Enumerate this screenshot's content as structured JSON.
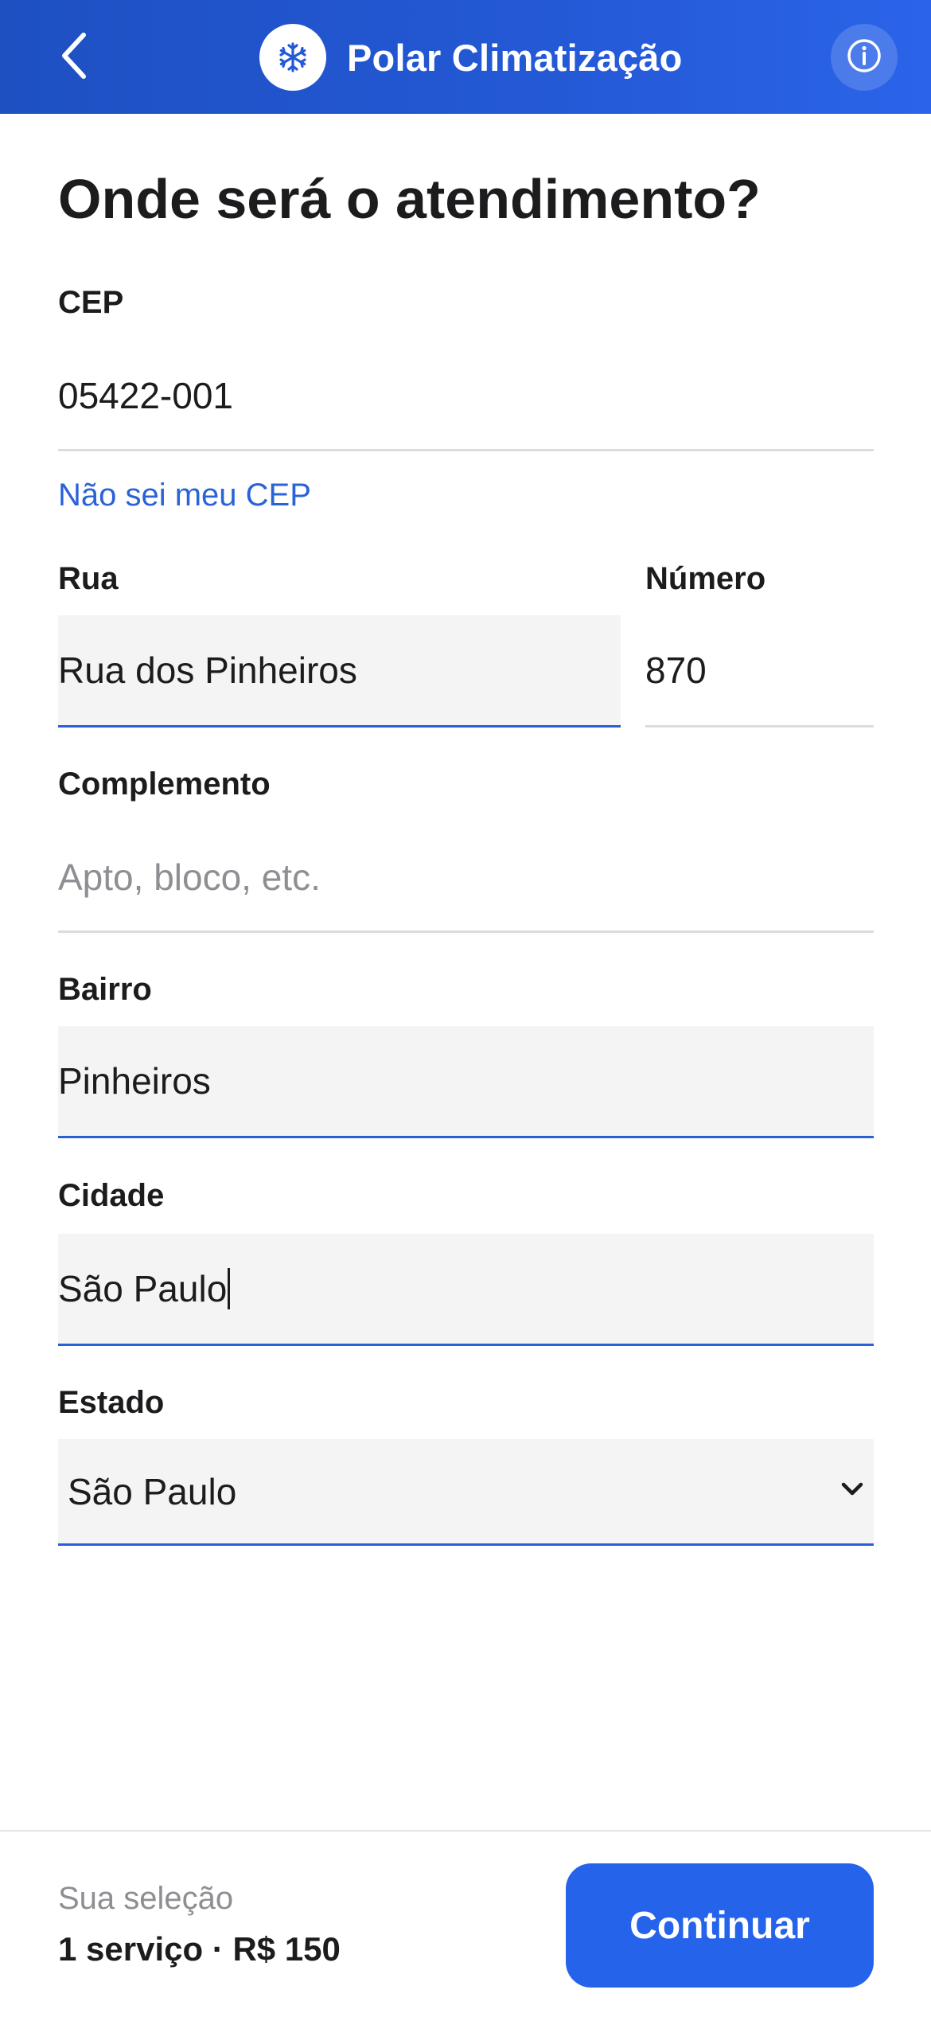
{
  "header": {
    "back_icon": "chevron-left-icon",
    "logo_icon": "snowflake-icon",
    "title": "Polar Climatização",
    "info_icon": "info-icon",
    "colors": {
      "gradient_start": "#1e50c2",
      "gradient_end": "#2b64ea"
    }
  },
  "page": {
    "title": "Onde será o atendimento?"
  },
  "form": {
    "cep": {
      "label": "CEP",
      "value": "05422-001"
    },
    "cep_help_link": "Não sei meu CEP",
    "rua": {
      "label": "Rua",
      "value": "Rua dos Pinheiros"
    },
    "numero": {
      "label": "Número",
      "value": "870"
    },
    "complemento": {
      "label": "Complemento",
      "value": "",
      "placeholder": "Apto, bloco, etc."
    },
    "bairro": {
      "label": "Bairro",
      "value": "Pinheiros"
    },
    "cidade": {
      "label": "Cidade",
      "value": "São Paulo"
    },
    "estado": {
      "label": "Estado",
      "selected": "São Paulo",
      "icon": "chevron-down-icon"
    }
  },
  "footer": {
    "selection_label": "Sua seleção",
    "selection_summary": "1 serviço · R$ 150",
    "continue_label": "Continuar"
  },
  "colors": {
    "accent": "#2563eb",
    "link": "#2a63d8",
    "active_underline": "#2a5fd8",
    "field_fill": "#f4f4f4"
  }
}
